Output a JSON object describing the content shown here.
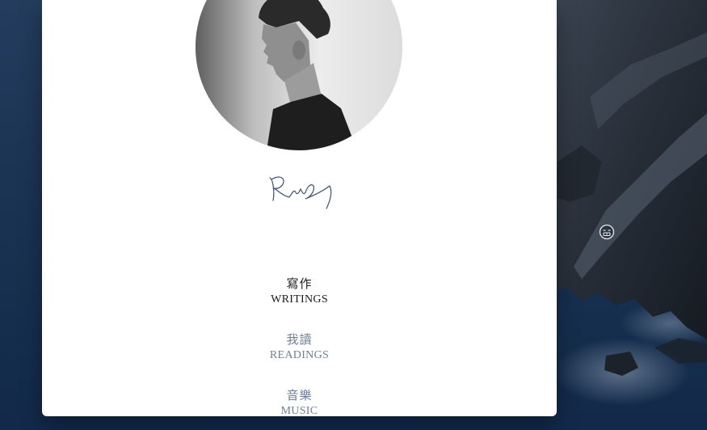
{
  "profile": {
    "avatar_icon": "profile-photo"
  },
  "navigation": [
    {
      "zh": "寫作",
      "en": "WRITINGS",
      "state": "active"
    },
    {
      "zh": "我讀",
      "en": "READINGS",
      "state": "link"
    },
    {
      "zh": "音樂",
      "en": "MUSIC",
      "state": "link"
    }
  ],
  "colors": {
    "window_background": "#ffffff",
    "active_text": "#1b1b1b",
    "link_text": "#6d809a",
    "wallpaper_ocean": "#1d3555"
  },
  "icons": {
    "signature": "handwritten-signature-icon",
    "desktop_badge": "face-badge-icon"
  }
}
